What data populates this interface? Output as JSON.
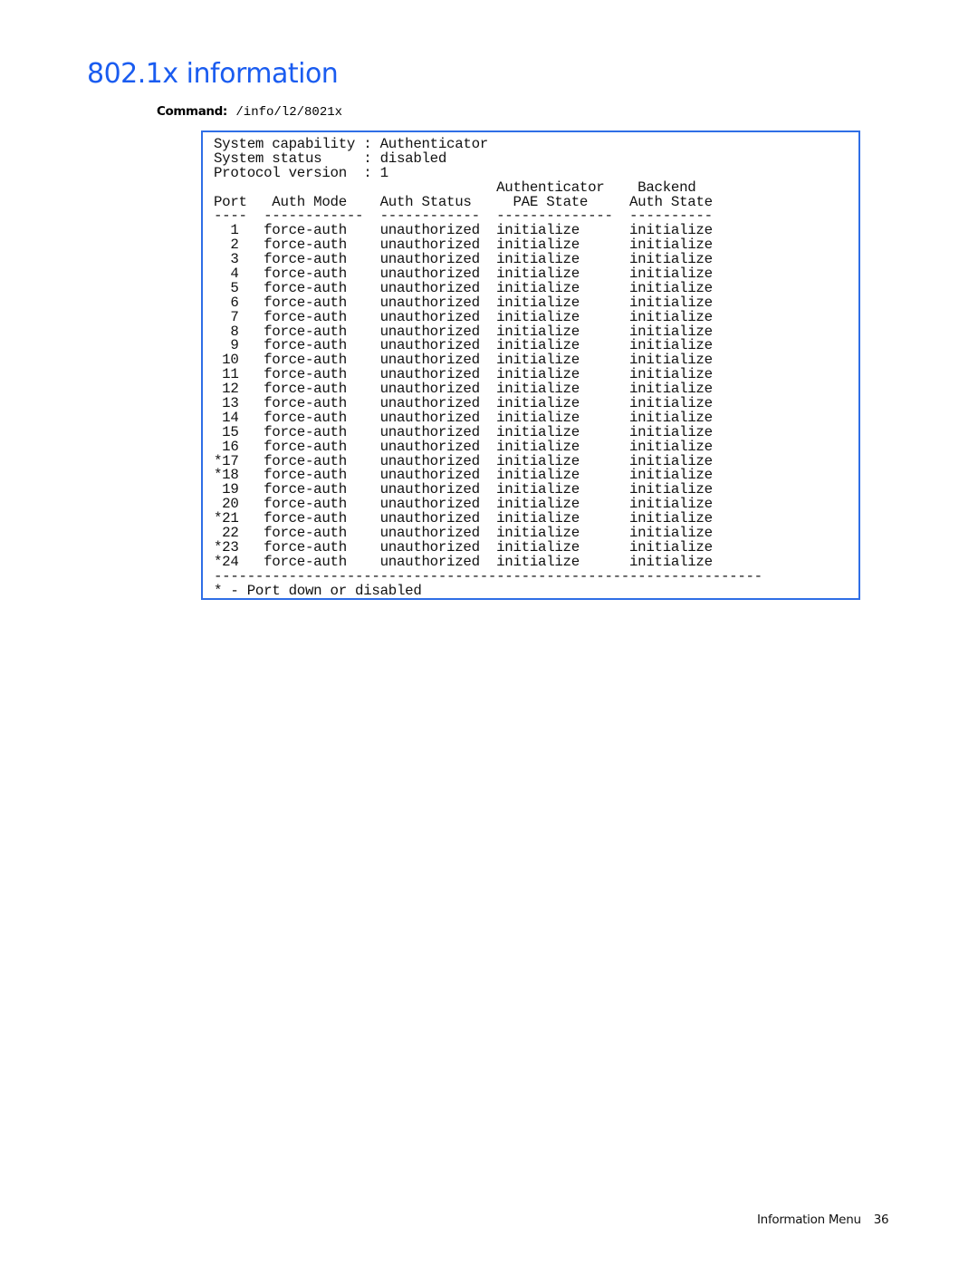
{
  "page": {
    "title": "802.1x information",
    "command_label": "Command:",
    "command_value": "/info/l2/8021x",
    "footer_section": "Information Menu",
    "footer_page": "36"
  },
  "terminal": {
    "summary": [
      {
        "label": "System capability",
        "value": "Authenticator"
      },
      {
        "label": "System status",
        "value": "disabled"
      },
      {
        "label": "Protocol version",
        "value": "1"
      }
    ],
    "header_top": {
      "pae": "Authenticator",
      "backend": "Backend"
    },
    "columns": [
      "Port",
      "Auth Mode",
      "Auth Status",
      "PAE State",
      "Auth State"
    ],
    "rows": [
      {
        "port": "1",
        "mode": "force-auth",
        "status": "unauthorized",
        "pae": "initialize",
        "backend": "initialize"
      },
      {
        "port": "2",
        "mode": "force-auth",
        "status": "unauthorized",
        "pae": "initialize",
        "backend": "initialize"
      },
      {
        "port": "3",
        "mode": "force-auth",
        "status": "unauthorized",
        "pae": "initialize",
        "backend": "initialize"
      },
      {
        "port": "4",
        "mode": "force-auth",
        "status": "unauthorized",
        "pae": "initialize",
        "backend": "initialize"
      },
      {
        "port": "5",
        "mode": "force-auth",
        "status": "unauthorized",
        "pae": "initialize",
        "backend": "initialize"
      },
      {
        "port": "6",
        "mode": "force-auth",
        "status": "unauthorized",
        "pae": "initialize",
        "backend": "initialize"
      },
      {
        "port": "7",
        "mode": "force-auth",
        "status": "unauthorized",
        "pae": "initialize",
        "backend": "initialize"
      },
      {
        "port": "8",
        "mode": "force-auth",
        "status": "unauthorized",
        "pae": "initialize",
        "backend": "initialize"
      },
      {
        "port": "9",
        "mode": "force-auth",
        "status": "unauthorized",
        "pae": "initialize",
        "backend": "initialize"
      },
      {
        "port": "10",
        "mode": "force-auth",
        "status": "unauthorized",
        "pae": "initialize",
        "backend": "initialize"
      },
      {
        "port": "11",
        "mode": "force-auth",
        "status": "unauthorized",
        "pae": "initialize",
        "backend": "initialize"
      },
      {
        "port": "12",
        "mode": "force-auth",
        "status": "unauthorized",
        "pae": "initialize",
        "backend": "initialize"
      },
      {
        "port": "13",
        "mode": "force-auth",
        "status": "unauthorized",
        "pae": "initialize",
        "backend": "initialize"
      },
      {
        "port": "14",
        "mode": "force-auth",
        "status": "unauthorized",
        "pae": "initialize",
        "backend": "initialize"
      },
      {
        "port": "15",
        "mode": "force-auth",
        "status": "unauthorized",
        "pae": "initialize",
        "backend": "initialize"
      },
      {
        "port": "16",
        "mode": "force-auth",
        "status": "unauthorized",
        "pae": "initialize",
        "backend": "initialize"
      },
      {
        "port": "*17",
        "mode": "force-auth",
        "status": "unauthorized",
        "pae": "initialize",
        "backend": "initialize"
      },
      {
        "port": "*18",
        "mode": "force-auth",
        "status": "unauthorized",
        "pae": "initialize",
        "backend": "initialize"
      },
      {
        "port": "19",
        "mode": "force-auth",
        "status": "unauthorized",
        "pae": "initialize",
        "backend": "initialize"
      },
      {
        "port": "20",
        "mode": "force-auth",
        "status": "unauthorized",
        "pae": "initialize",
        "backend": "initialize"
      },
      {
        "port": "*21",
        "mode": "force-auth",
        "status": "unauthorized",
        "pae": "initialize",
        "backend": "initialize"
      },
      {
        "port": "22",
        "mode": "force-auth",
        "status": "unauthorized",
        "pae": "initialize",
        "backend": "initialize"
      },
      {
        "port": "*23",
        "mode": "force-auth",
        "status": "unauthorized",
        "pae": "initialize",
        "backend": "initialize"
      },
      {
        "port": "*24",
        "mode": "force-auth",
        "status": "unauthorized",
        "pae": "initialize",
        "backend": "initialize"
      }
    ],
    "legend": "* - Port down or disabled"
  }
}
